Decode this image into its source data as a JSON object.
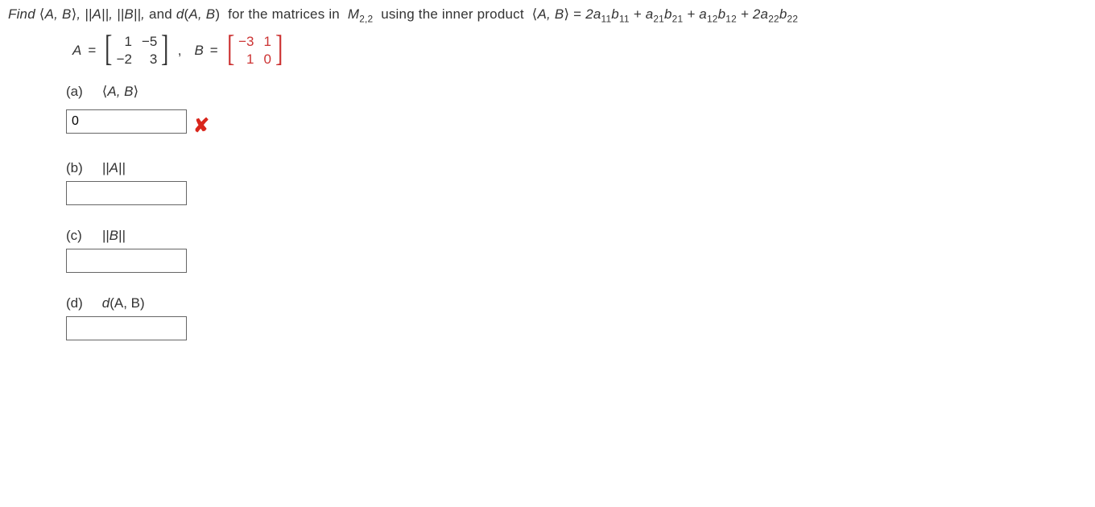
{
  "problem": {
    "intro": "Find ⟨A, B⟩, ||A||, ||B||, and d(A, B) for the matrices in M",
    "space_sub": "2,2",
    "intro2": " using the inner product ⟨A, B⟩ = 2a",
    "t1s": "11",
    "t1b": "b",
    "t1bs": "11",
    "plus1": " + a",
    "t2s": "21",
    "t2b": "b",
    "t2bs": "21",
    "plus2": " + a",
    "t3s": "12",
    "t3b": "b",
    "t3bs": "12",
    "plus3": " + 2a",
    "t4s": "22",
    "t4b": "b",
    "t4bs": "22"
  },
  "matrices": {
    "A_label": "A",
    "eq": "=",
    "A": {
      "r0c0": "1",
      "r0c1": "−5",
      "r1c0": "−2",
      "r1c1": "3"
    },
    "comma": ",",
    "B_label": "B",
    "B": {
      "r0c0": "−3",
      "r0c1": "1",
      "r1c0": "1",
      "r1c1": "0"
    }
  },
  "parts": {
    "a": {
      "label": "(a)",
      "expr": "⟨A, B⟩",
      "answer": "0",
      "feedback": "✘"
    },
    "b": {
      "label": "(b)",
      "expr": "||A||",
      "answer": ""
    },
    "c": {
      "label": "(c)",
      "expr": "||B||",
      "answer": ""
    },
    "d": {
      "label": "(d)",
      "expr_pre": "d",
      "expr_args": "(A, B)",
      "answer": ""
    }
  }
}
